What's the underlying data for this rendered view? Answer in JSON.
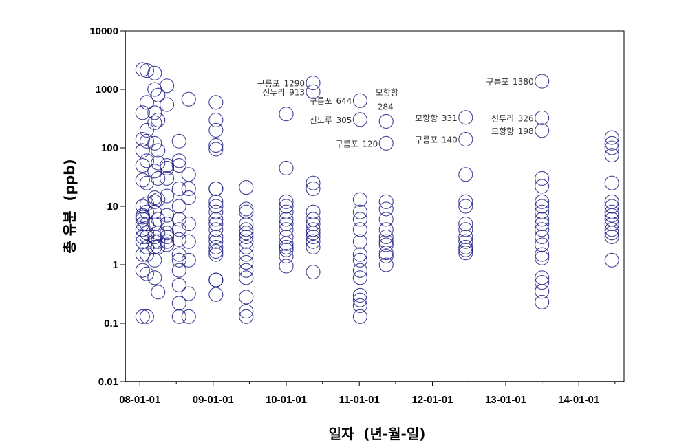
{
  "chart_data": {
    "type": "scatter",
    "title": "",
    "xlabel": "일자  (년-월-일)",
    "ylabel": "총 유분  (ppb)",
    "yscale": "log",
    "ylim": [
      0.01,
      10000
    ],
    "xlim": [
      "2007-10-20",
      "2014-08-15"
    ],
    "yticks": [
      "0.01",
      "0.1",
      "1",
      "10",
      "100",
      "1000",
      "10000"
    ],
    "xticks": [
      {
        "date": "2008-01-01",
        "label": "08-01-01"
      },
      {
        "date": "2009-01-01",
        "label": "09-01-01"
      },
      {
        "date": "2010-01-01",
        "label": "10-01-01"
      },
      {
        "date": "2011-01-01",
        "label": "11-01-01"
      },
      {
        "date": "2012-01-01",
        "label": "12-01-01"
      },
      {
        "date": "2013-01-01",
        "label": "13-01-01"
      },
      {
        "date": "2014-01-01",
        "label": "14-01-01"
      }
    ],
    "grid": false,
    "marker": "open-circle",
    "marker_color": "#1f1f85",
    "series": [
      {
        "date": "2008-01-15",
        "values": [
          2200,
          400,
          140,
          90,
          50,
          28,
          10,
          7,
          6.5,
          6,
          5,
          4,
          3,
          2.5,
          1.5,
          0.8,
          0.13
        ]
      },
      {
        "date": "2008-02-05",
        "values": [
          2100,
          600,
          200,
          130,
          60,
          25,
          11,
          8,
          5,
          3.5,
          3,
          2,
          1.5,
          0.7,
          0.13
        ]
      },
      {
        "date": "2008-03-15",
        "values": [
          1900,
          1000,
          400,
          270,
          120,
          40,
          14,
          12,
          8,
          5,
          3,
          2.5,
          2,
          1.2,
          0.6
        ]
      },
      {
        "date": "2008-04-01",
        "values": [
          800,
          300,
          90,
          55,
          30,
          13,
          6,
          3.5,
          2.5,
          2,
          0.34
        ]
      },
      {
        "date": "2008-05-15",
        "values": [
          1150,
          550,
          50,
          45,
          30,
          15,
          7,
          5,
          3.5,
          3,
          2.5,
          2.2
        ]
      },
      {
        "date": "2008-07-15",
        "values": [
          130,
          60,
          50,
          20,
          10,
          6,
          4,
          2.7,
          1.5,
          1.2,
          0.8,
          0.45,
          0.22,
          0.13
        ]
      },
      {
        "date": "2008-09-01",
        "values": [
          680,
          35,
          20,
          14,
          5,
          2.5,
          1.2,
          0.32,
          0.13
        ]
      },
      {
        "date": "2009-01-15",
        "values": [
          600,
          300,
          200,
          110,
          95,
          20,
          20,
          12,
          10,
          8,
          6,
          5,
          4,
          3,
          2.5,
          2,
          1.7,
          1.5,
          0.55,
          0.55,
          0.31
        ]
      },
      {
        "date": "2009-06-15",
        "values": [
          21,
          9,
          8,
          5,
          4,
          3.5,
          3,
          2.5,
          2,
          1.5,
          1.1,
          0.8,
          0.6,
          0.28,
          0.16,
          0.13
        ]
      },
      {
        "date": "2010-01-01",
        "values": [
          380,
          45,
          12,
          10,
          8,
          6,
          5,
          4,
          3,
          2.3,
          2,
          1.8,
          1.4,
          0.95
        ]
      },
      {
        "date": "2010-05-15",
        "values": [
          1290,
          913,
          25,
          20,
          8,
          6,
          5,
          4,
          3.5,
          3,
          2.5,
          2,
          0.75
        ]
      },
      {
        "date": "2011-01-05",
        "values": [
          644,
          305,
          13,
          8,
          6,
          4,
          2.5,
          1.5,
          1.2,
          0.8,
          0.6,
          0.3,
          0.25,
          0.2,
          0.13
        ]
      },
      {
        "date": "2011-05-15",
        "values": [
          284,
          120,
          12,
          9,
          6,
          4,
          3,
          2.5,
          2.2,
          1.6,
          1.4,
          1.0
        ]
      },
      {
        "date": "2012-06-15",
        "values": [
          331,
          140,
          35,
          12,
          10,
          5,
          4,
          3,
          2.5,
          2,
          1.8,
          1.6
        ]
      },
      {
        "date": "2013-07-01",
        "values": [
          1380,
          326,
          198,
          30,
          22,
          12,
          10,
          8,
          6,
          5,
          4,
          3,
          2.2,
          1.5,
          1.3,
          0.6,
          0.5,
          0.35,
          0.23
        ]
      },
      {
        "date": "2014-06-15",
        "values": [
          150,
          120,
          100,
          75,
          25,
          12,
          10,
          8,
          7,
          6,
          5,
          4,
          3.5,
          3,
          1.2
        ]
      }
    ],
    "annotations": [
      {
        "name": "구름포",
        "value": "1290",
        "date": "2010-05-15",
        "y": 1290
      },
      {
        "name": "신두리",
        "value": "913",
        "date": "2010-05-15",
        "y": 913
      },
      {
        "name": "구름포",
        "value": "644",
        "date": "2011-01-05",
        "y": 644
      },
      {
        "name": "신노루",
        "value": "305",
        "date": "2011-01-05",
        "y": 305
      },
      {
        "name": "모항항",
        "value": "284",
        "date": "2011-05-15",
        "y": 284
      },
      {
        "name": "구름포",
        "value": "120",
        "date": "2011-05-15",
        "y": 120
      },
      {
        "name": "모항항",
        "value": "331",
        "date": "2012-06-15",
        "y": 331
      },
      {
        "name": "구름포",
        "value": "140",
        "date": "2012-06-15",
        "y": 140
      },
      {
        "name": "구름포",
        "value": "1380",
        "date": "2013-07-01",
        "y": 1380
      },
      {
        "name": "신두리",
        "value": "326",
        "date": "2013-07-01",
        "y": 326
      },
      {
        "name": "모항항",
        "value": "198",
        "date": "2013-07-01",
        "y": 198
      }
    ]
  }
}
